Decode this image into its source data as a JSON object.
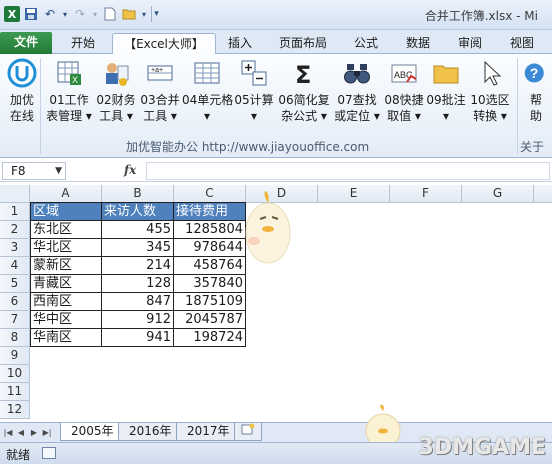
{
  "window": {
    "title": "合并工作簿.xlsx - Mi",
    "app_icon": "X"
  },
  "ribbon_tabs": [
    {
      "label": "文件"
    },
    {
      "label": "开始"
    },
    {
      "label": "【Excel大师】"
    },
    {
      "label": "插入"
    },
    {
      "label": "页面布局"
    },
    {
      "label": "公式"
    },
    {
      "label": "数据"
    },
    {
      "label": "审阅"
    },
    {
      "label": "视图"
    }
  ],
  "ribbon_buttons": [
    {
      "line1": "加优",
      "line2": "在线",
      "icon": "jiayou-logo-icon"
    },
    {
      "line1": "01工作",
      "line2": "表管理 ▾",
      "icon": "worksheet-manage-icon"
    },
    {
      "line1": "02财务",
      "line2": "工具 ▾",
      "icon": "finance-tools-icon"
    },
    {
      "line1": "03合并",
      "line2": "工具 ▾",
      "icon": "merge-tools-icon"
    },
    {
      "line1": "04单元格",
      "line2": "▾",
      "icon": "cell-grid-icon"
    },
    {
      "line1": "05计算",
      "line2": "▾",
      "icon": "plus-minus-icon"
    },
    {
      "line1": "06简化复",
      "line2": "杂公式 ▾",
      "icon": "sigma-icon"
    },
    {
      "line1": "07查找",
      "line2": "或定位 ▾",
      "icon": "binoculars-icon"
    },
    {
      "line1": "08快捷",
      "line2": "取值 ▾",
      "icon": "abc-spell-icon"
    },
    {
      "line1": "09批注",
      "line2": "▾",
      "icon": "folder-comment-icon"
    },
    {
      "line1": "10选区",
      "line2": "转换 ▾",
      "icon": "cursor-select-icon"
    },
    {
      "line1": "帮",
      "line2": "助",
      "icon": "help-icon"
    }
  ],
  "ribbon_groups": {
    "main_label": "加优智能办公  http://www.jiayouoffice.com",
    "about_label": "关于"
  },
  "formula_bar": {
    "name_box": "F8",
    "fx": "fx",
    "value": ""
  },
  "columns": [
    "A",
    "B",
    "C",
    "D",
    "E",
    "F",
    "G"
  ],
  "rows": [
    "1",
    "2",
    "3",
    "4",
    "5",
    "6",
    "7",
    "8",
    "9",
    "10",
    "11",
    "12"
  ],
  "table": {
    "headers": [
      "区域",
      "来访人数",
      "接待费用"
    ],
    "rows": [
      [
        "东北区",
        "455",
        "1285804"
      ],
      [
        "华北区",
        "345",
        "978644"
      ],
      [
        "蒙新区",
        "214",
        "458764"
      ],
      [
        "青藏区",
        "128",
        "357840"
      ],
      [
        "西南区",
        "847",
        "1875109"
      ],
      [
        "华中区",
        "912",
        "2045787"
      ],
      [
        "华南区",
        "941",
        "198724"
      ]
    ]
  },
  "sheet_tabs": [
    {
      "label": "2005年"
    },
    {
      "label": "2016年"
    },
    {
      "label": "2017年"
    }
  ],
  "status": {
    "text": "就绪"
  },
  "watermark": "3DMGAME",
  "colors": {
    "header_fill": "#4f81bd",
    "file_tab": "#217a36"
  }
}
